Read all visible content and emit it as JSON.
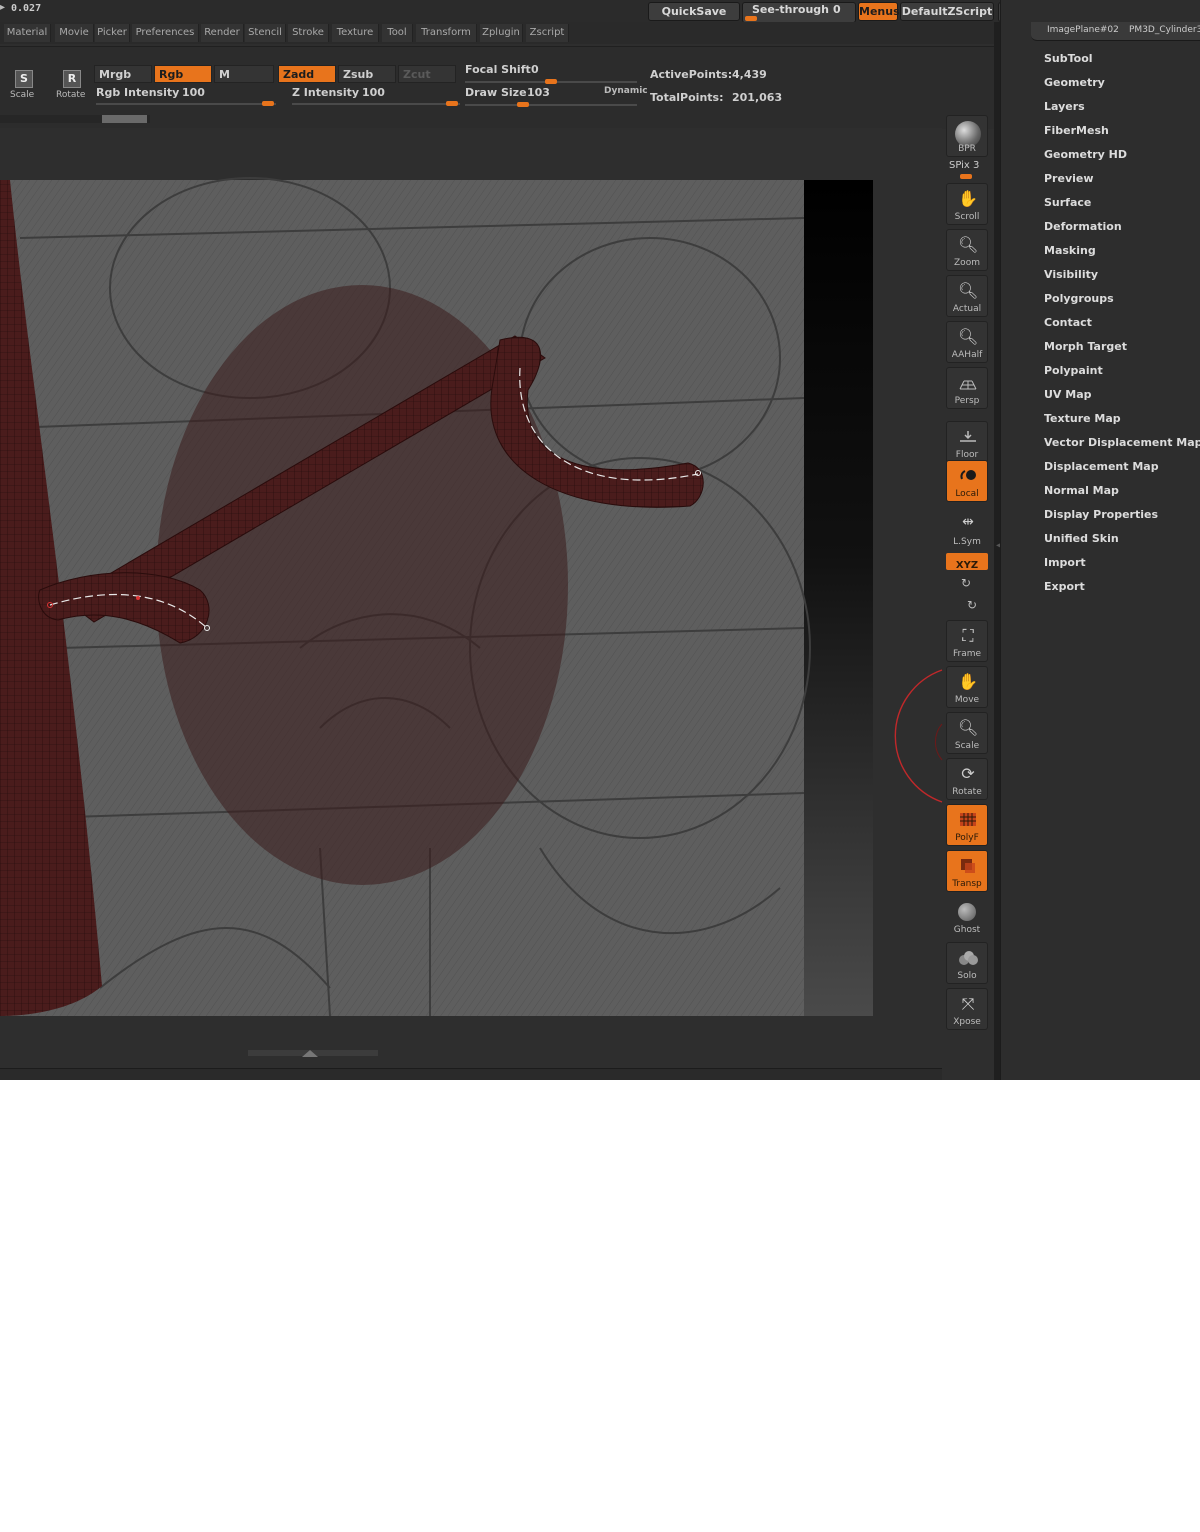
{
  "topbar": {
    "value_readout": "0.027",
    "quicksave": "QuickSave",
    "seethrough_label": "See-through",
    "seethrough_value": "0",
    "menus": "Menus",
    "script": "DefaultZScript",
    "thumb1": "ImagePlane#02",
    "thumb2": "PM3D_Cylinder3"
  },
  "menus": [
    "Material",
    "Movie",
    "Picker",
    "Preferences",
    "Render",
    "Stencil",
    "Stroke",
    "Texture",
    "Tool",
    "Transform",
    "Zplugin",
    "Zscript"
  ],
  "tools": {
    "scale_letter": "S",
    "scale": "Scale",
    "rotate_letter": "R",
    "rotate": "Rotate",
    "mrgb": "Mrgb",
    "rgb": "Rgb",
    "m": "M",
    "zadd": "Zadd",
    "zsub": "Zsub",
    "zcut": "Zcut",
    "rgb_intensity_label": "Rgb Intensity",
    "rgb_intensity": "100",
    "z_intensity_label": "Z Intensity",
    "z_intensity": "100",
    "focal_shift_label": "Focal Shift",
    "focal_shift": "0",
    "draw_size_label": "Draw Size",
    "draw_size": "103",
    "dynamic": "Dynamic",
    "active_points_label": "ActivePoints:",
    "active_points": "4,439",
    "total_points_label": "TotalPoints:",
    "total_points": "201,063"
  },
  "right_panel": [
    "SubTool",
    "Geometry",
    "Layers",
    "FiberMesh",
    "Geometry HD",
    "Preview",
    "Surface",
    "Deformation",
    "Masking",
    "Visibility",
    "Polygroups",
    "Contact",
    "Morph Target",
    "Polypaint",
    "UV Map",
    "Texture Map",
    "Vector Displacement Map",
    "Displacement Map",
    "Normal Map",
    "Display Properties",
    "Unified Skin",
    "Import",
    "Export"
  ],
  "side_toolbar": {
    "bpr": "BPR",
    "spix": "SPix 3",
    "scroll": "Scroll",
    "zoom": "Zoom",
    "actual": "Actual",
    "aahalf": "AAHalf",
    "persp": "Persp",
    "floor": "Floor",
    "local": "Local",
    "lsym": "L.Sym",
    "xyz": "XYZ",
    "frame": "Frame",
    "move": "Move",
    "scale": "Scale",
    "rotate": "Rotate",
    "polyf": "PolyF",
    "transp": "Transp",
    "ghost": "Ghost",
    "solo": "Solo",
    "xpose": "Xpose"
  },
  "colors": {
    "accent": "#e8741c",
    "mesh": "#4a1c1c",
    "brush_ring": "#c0282a"
  }
}
